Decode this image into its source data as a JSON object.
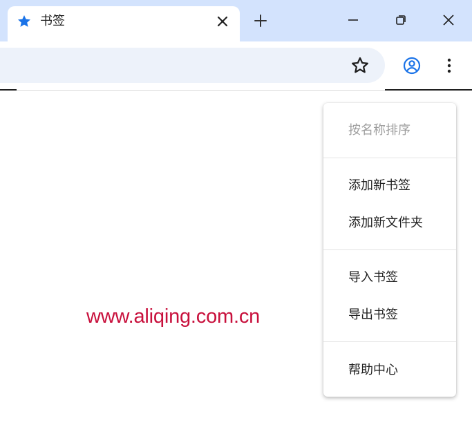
{
  "tab": {
    "title": "书签",
    "icon": "star-icon"
  },
  "toolbar": {
    "bookmark_star_icon": "star-outline-icon",
    "profile_icon": "account-circle-icon",
    "more_icon": "more-vertical-icon"
  },
  "window_controls": {
    "new_tab_icon": "plus-icon",
    "minimize_icon": "minimize-icon",
    "restore_icon": "restore-icon",
    "close_icon": "close-icon"
  },
  "menu": {
    "items": [
      {
        "label": "按名称排序",
        "enabled": false
      },
      {
        "label": "添加新书签",
        "enabled": true
      },
      {
        "label": "添加新文件夹",
        "enabled": true
      },
      {
        "label": "导入书签",
        "enabled": true
      },
      {
        "label": "导出书签",
        "enabled": true
      },
      {
        "label": "帮助中心",
        "enabled": true
      }
    ]
  },
  "watermark": "www.aliqing.com.cn",
  "colors": {
    "tab_strip": "#d3e3fd",
    "omnibox": "#edf2fa",
    "accent_blue": "#1a73e8",
    "watermark": "#c8103c",
    "menu_disabled_text": "#9e9e9e"
  }
}
